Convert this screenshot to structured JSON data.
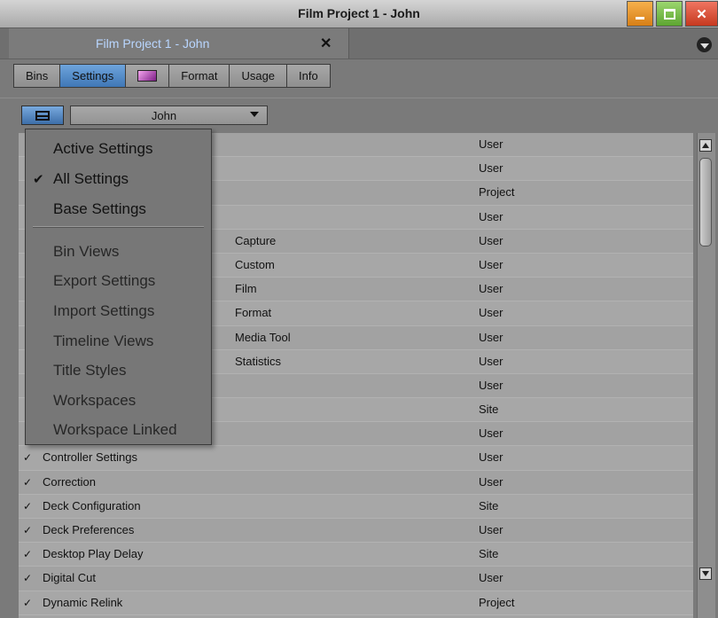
{
  "window": {
    "title": "Film Project 1 - John"
  },
  "doc_tab": {
    "label": "Film Project 1 - John"
  },
  "subtabs": [
    "Bins",
    "Settings",
    "",
    "Format",
    "Usage",
    "Info"
  ],
  "toolbar": {
    "user_value": "John"
  },
  "dropdown": {
    "items": [
      {
        "label": "Active Settings",
        "checked": false
      },
      {
        "label": "All Settings",
        "checked": true
      },
      {
        "label": "Base Settings",
        "checked": false
      },
      {
        "label": "Bin Views",
        "checked": false
      },
      {
        "label": "Export Settings",
        "checked": false
      },
      {
        "label": "Import Settings",
        "checked": false
      },
      {
        "label": "Timeline Views",
        "checked": false
      },
      {
        "label": "Title Styles",
        "checked": false
      },
      {
        "label": "Workspaces",
        "checked": false
      },
      {
        "label": "Workspace Linked",
        "checked": false
      }
    ],
    "check_mark": "✔"
  },
  "rows": [
    {
      "check": "",
      "name": "",
      "kind": "",
      "scope": "User"
    },
    {
      "check": "",
      "name": "",
      "kind": "",
      "scope": "User"
    },
    {
      "check": "",
      "name": "",
      "kind": "",
      "scope": "Project"
    },
    {
      "check": "",
      "name": "",
      "kind": "",
      "scope": "User"
    },
    {
      "check": "",
      "name": "",
      "kind": "Capture",
      "scope": "User"
    },
    {
      "check": "",
      "name": "",
      "kind": "Custom",
      "scope": "User"
    },
    {
      "check": "",
      "name": "",
      "kind": "Film",
      "scope": "User"
    },
    {
      "check": "",
      "name": "",
      "kind": "Format",
      "scope": "User"
    },
    {
      "check": "",
      "name": "",
      "kind": "Media Tool",
      "scope": "User"
    },
    {
      "check": "",
      "name": "",
      "kind": "Statistics",
      "scope": "User"
    },
    {
      "check": "",
      "name": "",
      "kind": "",
      "scope": "User"
    },
    {
      "check": "",
      "name": "",
      "kind": "",
      "scope": "Site"
    },
    {
      "check": "",
      "name": "",
      "kind": "",
      "scope": "User"
    },
    {
      "check": "✓",
      "name": "Controller Settings",
      "kind": "",
      "scope": "User"
    },
    {
      "check": "✓",
      "name": "Correction",
      "kind": "",
      "scope": "User"
    },
    {
      "check": "✓",
      "name": "Deck Configuration",
      "kind": "",
      "scope": "Site"
    },
    {
      "check": "✓",
      "name": "Deck Preferences",
      "kind": "",
      "scope": "User"
    },
    {
      "check": "✓",
      "name": "Desktop Play Delay",
      "kind": "",
      "scope": "Site"
    },
    {
      "check": "✓",
      "name": "Digital Cut",
      "kind": "",
      "scope": "User"
    },
    {
      "check": "✓",
      "name": "Dynamic Relink",
      "kind": "",
      "scope": "Project"
    }
  ],
  "colors": {
    "accent": "#4a80c0",
    "tab_label": "#b9d6ff"
  }
}
